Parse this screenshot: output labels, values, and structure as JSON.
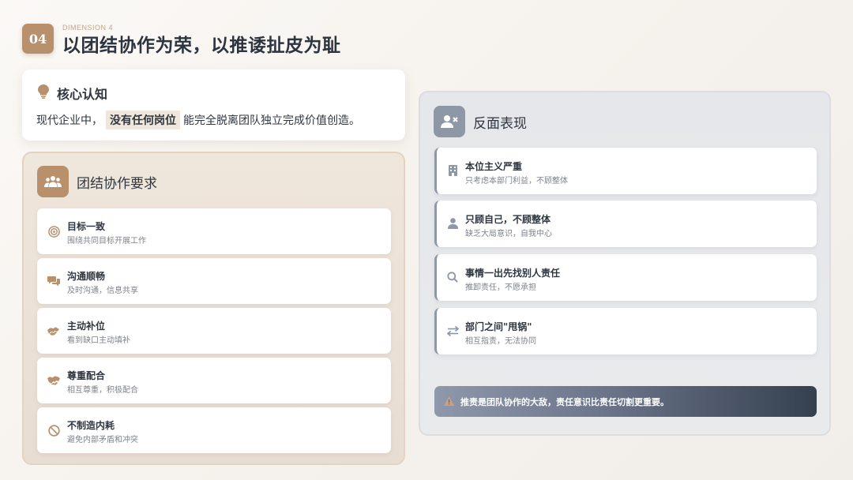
{
  "header": {
    "number": "04",
    "dimension_label": "DIMENSION 4",
    "title": "以团结协作为荣，以推诿扯皮为耻"
  },
  "core": {
    "icon": "lightbulb-icon",
    "title": "核心认知",
    "text_before": "现代企业中，",
    "highlight": "没有任何岗位",
    "text_after": "能完全脱离团队独立完成价值创造。"
  },
  "requirements": {
    "icon": "users-icon",
    "title": "团结协作要求",
    "items": [
      {
        "icon": "target-icon",
        "title": "目标一致",
        "desc": "围绕共同目标开展工作"
      },
      {
        "icon": "chat-icon",
        "title": "沟通顺畅",
        "desc": "及时沟通，信息共享"
      },
      {
        "icon": "hands-helping-icon",
        "title": "主动补位",
        "desc": "看到缺口主动填补"
      },
      {
        "icon": "handshake-icon",
        "title": "尊重配合",
        "desc": "相互尊重，积极配合"
      },
      {
        "icon": "ban-icon",
        "title": "不制造内耗",
        "desc": "避免内部矛盾和冲突"
      }
    ]
  },
  "negatives": {
    "icon": "user-x-icon",
    "title": "反面表现",
    "items": [
      {
        "icon": "building-icon",
        "title": "本位主义严重",
        "desc": "只考虑本部门利益，不顾整体"
      },
      {
        "icon": "user-icon",
        "title": "只顾自己，不顾整体",
        "desc": "缺乏大局意识，自我中心"
      },
      {
        "icon": "search-icon",
        "title": "事情一出先找别人责任",
        "desc": "推卸责任，不愿承担"
      },
      {
        "icon": "exchange-icon",
        "title": "部门之间\"甩锅\"",
        "desc": "相互指责，无法协同"
      }
    ],
    "warning_icon": "warning-icon",
    "warning": "推责是团队协作的大敌，责任意识比责任切割更重要。"
  },
  "colors": {
    "accent": "#b8916c",
    "slate": "#8e97a6",
    "text": "#2f3640"
  }
}
